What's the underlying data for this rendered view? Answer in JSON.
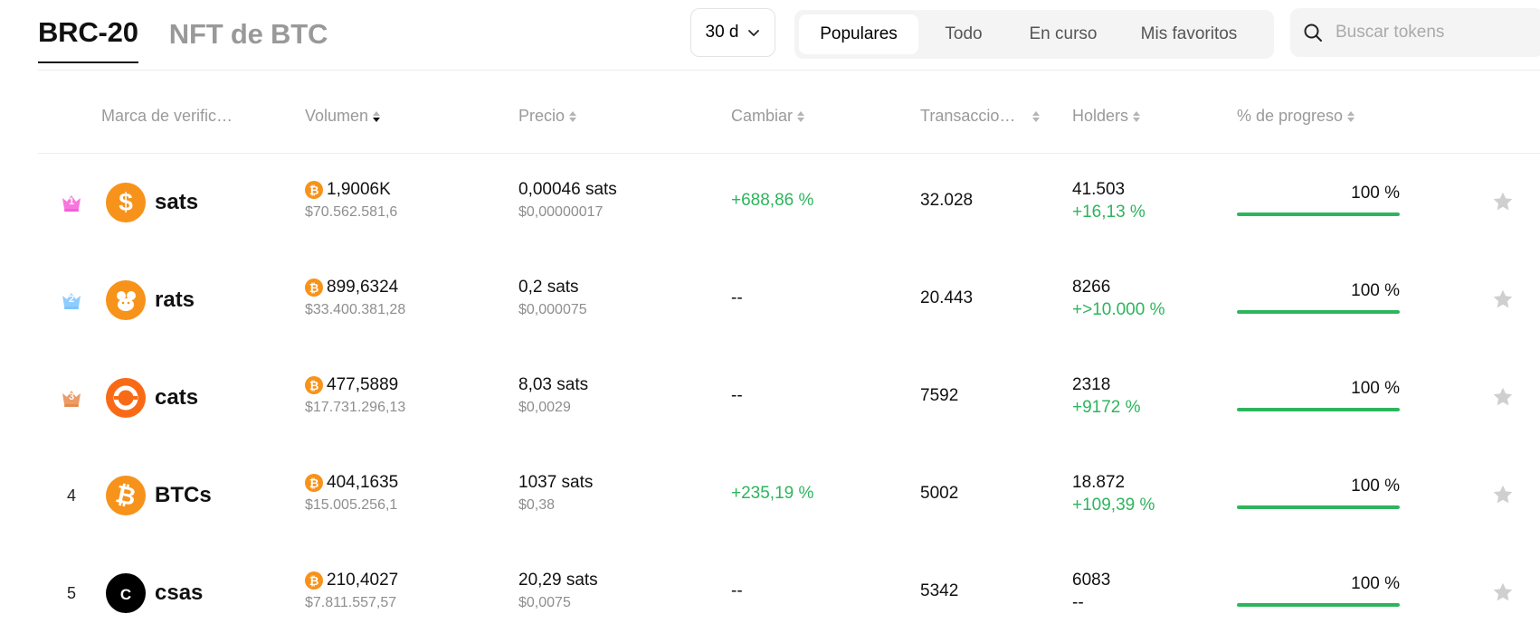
{
  "tabs": [
    {
      "label": "BRC-20",
      "active": true
    },
    {
      "label": "NFT de BTC",
      "active": false
    }
  ],
  "period": {
    "value": "30 d"
  },
  "filters": [
    {
      "label": "Populares",
      "active": true
    },
    {
      "label": "Todo",
      "active": false
    },
    {
      "label": "En curso",
      "active": false
    },
    {
      "label": "Mis favoritos",
      "active": false
    }
  ],
  "search": {
    "placeholder": "Buscar tokens"
  },
  "columns": {
    "verify": "Marca de verific…",
    "volume": "Volumen",
    "price": "Precio",
    "change": "Cambiar",
    "transactions": "Transaccio…",
    "holders": "Holders",
    "progress": "% de progreso"
  },
  "colors": {
    "accent_green": "#2db55d",
    "btc_orange": "#f7931a"
  },
  "rows": [
    {
      "rank": "1",
      "crown": "gold",
      "logo": "dollar-icon",
      "logo_color": "#f7931a",
      "name": "sats",
      "volume_btc": "1,9006K",
      "volume_usd": "$70.562.581,6",
      "price_sats": "0,00046 sats",
      "price_usd": "$0,00000017",
      "change": "+688,86 %",
      "change_positive": true,
      "transactions": "32.028",
      "holders": "41.503",
      "holders_change": "+16,13 %",
      "holders_change_positive": true,
      "progress_label": "100 %",
      "progress": 100
    },
    {
      "rank": "2",
      "crown": "silver",
      "logo": "rat-icon",
      "logo_color": "#f7931a",
      "name": "rats",
      "volume_btc": "899,6324",
      "volume_usd": "$33.400.381,28",
      "price_sats": "0,2 sats",
      "price_usd": "$0,000075",
      "change": "--",
      "change_positive": false,
      "transactions": "20.443",
      "holders": "8266",
      "holders_change": "+>10.000 %",
      "holders_change_positive": true,
      "progress_label": "100 %",
      "progress": 100
    },
    {
      "rank": "3",
      "crown": "bronze",
      "logo": "ring-icon",
      "logo_color": "#f96a16",
      "name": "cats",
      "volume_btc": "477,5889",
      "volume_usd": "$17.731.296,13",
      "price_sats": "8,03 sats",
      "price_usd": "$0,0029",
      "change": "--",
      "change_positive": false,
      "transactions": "7592",
      "holders": "2318",
      "holders_change": "+9172 %",
      "holders_change_positive": true,
      "progress_label": "100 %",
      "progress": 100
    },
    {
      "rank": "4",
      "crown": "",
      "logo": "bitcoin-icon",
      "logo_color": "#f7931a",
      "name": "BTCs",
      "volume_btc": "404,1635",
      "volume_usd": "$15.005.256,1",
      "price_sats": "1037 sats",
      "price_usd": "$0,38",
      "change": "+235,19 %",
      "change_positive": true,
      "transactions": "5002",
      "holders": "18.872",
      "holders_change": "+109,39 %",
      "holders_change_positive": true,
      "progress_label": "100 %",
      "progress": 100
    },
    {
      "rank": "5",
      "crown": "",
      "logo": "letter-c-icon",
      "logo_color": "#000000",
      "logo_text": "C",
      "name": "csas",
      "volume_btc": "210,4027",
      "volume_usd": "$7.811.557,57",
      "price_sats": "20,29 sats",
      "price_usd": "$0,0075",
      "change": "--",
      "change_positive": false,
      "transactions": "5342",
      "holders": "6083",
      "holders_change": "--",
      "holders_change_positive": false,
      "progress_label": "100 %",
      "progress": 100
    }
  ]
}
